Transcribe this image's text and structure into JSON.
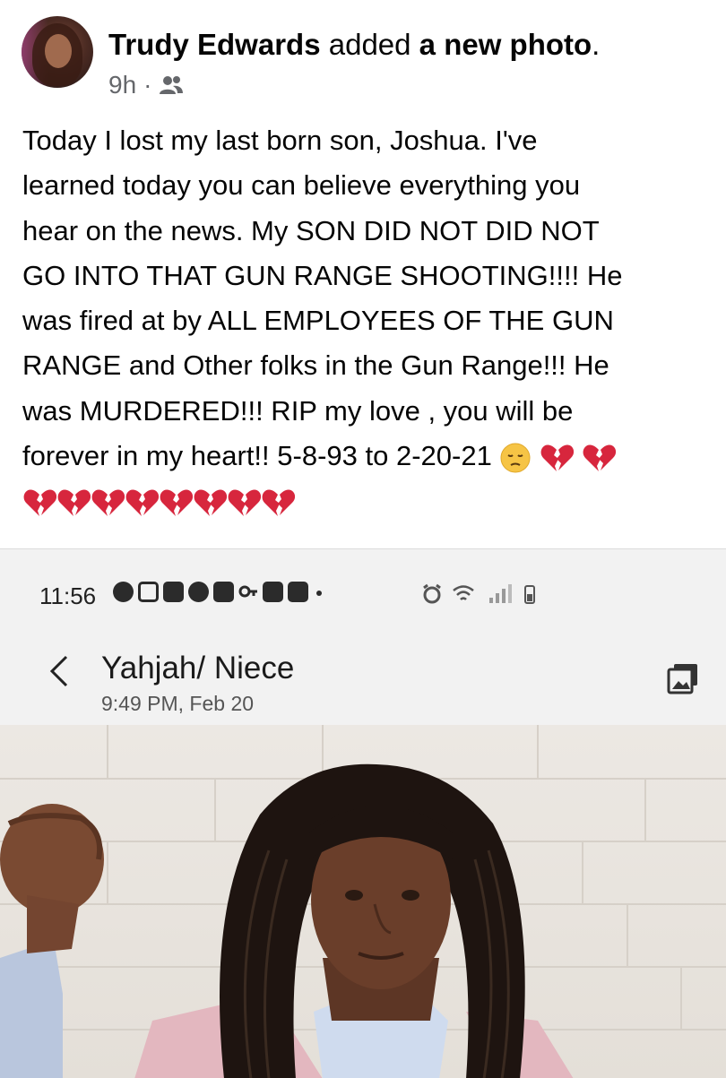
{
  "post": {
    "author": "Trudy Edwards",
    "action": "added",
    "object": "a new photo",
    "period": ".",
    "time": "9h",
    "separator": "·",
    "audience_icon": "friends-icon",
    "lines": [
      "Today I lost my last born son,  Joshua. I've",
      "learned today you can believe everything you",
      "hear on the news. My SON DID NOT DID NOT",
      "GO INTO THAT GUN RANGE SHOOTING!!!! He",
      "was fired at by ALL EMPLOYEES OF THE GUN",
      "RANGE and Other folks in the Gun Range!!! He",
      "was MURDERED!!! RIP my love , you will be",
      "forever in my heart!! 5-8-93 to 2-20-21"
    ],
    "emoji_after_text": [
      "pensive-face",
      "broken-heart",
      "broken-heart"
    ],
    "emoji_row": [
      "broken-heart",
      "broken-heart",
      "broken-heart",
      "broken-heart",
      "broken-heart",
      "broken-heart",
      "broken-heart",
      "broken-heart"
    ]
  },
  "screenshot": {
    "status_time": "11:56",
    "contact_name": "Yahjah/ Niece",
    "contact_date": "9:49 PM, Feb 20",
    "back_icon": "chevron-left-icon",
    "gallery_icon": "gallery-icon"
  },
  "colors": {
    "text": "#050505",
    "meta": "#65676b",
    "heart": "#d7263d",
    "status_bg": "#f2f2f2"
  }
}
